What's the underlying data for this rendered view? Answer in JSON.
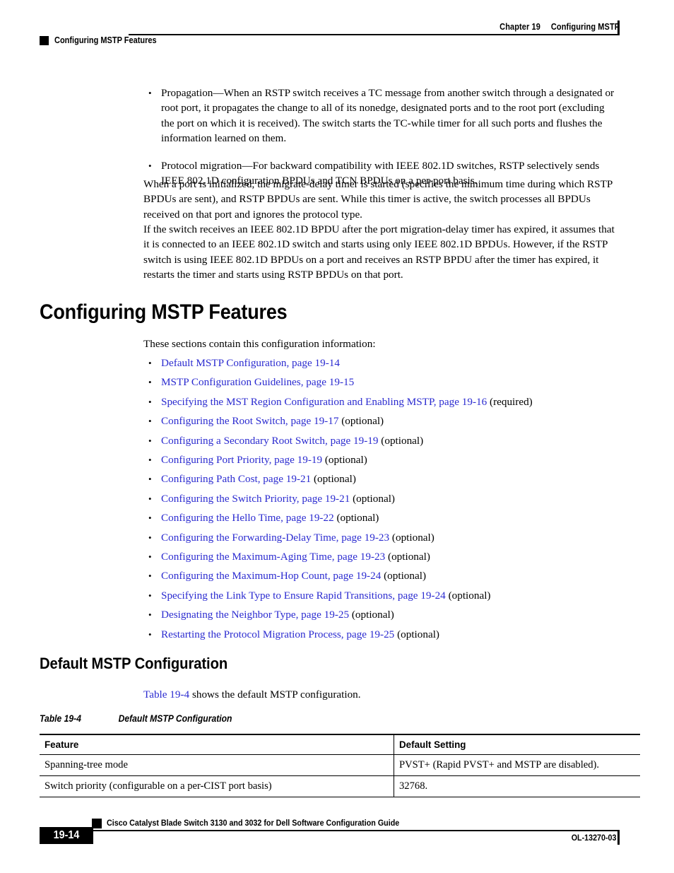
{
  "header": {
    "chapter_label": "Chapter 19",
    "chapter_title": "Configuring MSTP",
    "running_title": "Configuring MSTP Features"
  },
  "intro_bullets": [
    "Propagation—When an RSTP switch receives a TC message from another switch through a designated or root port, it propagates the change to all of its nonedge, designated ports and to the root port (excluding the port on which it is received). The switch starts the TC-while timer for all such ports and flushes the information learned on them.",
    "Protocol migration—For backward compatibility with IEEE 802.1D switches, RSTP selectively sends IEEE 802.1D configuration BPDUs and TCN BPDUs on a per-port basis."
  ],
  "paragraphs": [
    "When a port is initialized, the migrate-delay timer is started (specifies the minimum time during which RSTP BPDUs are sent), and RSTP BPDUs are sent. While this timer is active, the switch processes all BPDUs received on that port and ignores the protocol type.",
    "If the switch receives an IEEE 802.1D BPDU after the port migration-delay timer has expired, it assumes that it is connected to an IEEE 802.1D switch and starts using only IEEE 802.1D BPDUs. However, if the RSTP switch is using IEEE 802.1D BPDUs on a port and receives an RSTP BPDU after the timer has expired, it restarts the timer and starts using RSTP BPDUs on that port."
  ],
  "section": {
    "heading": "Configuring MSTP Features",
    "lead_in": "These sections contain this configuration information:",
    "links": [
      {
        "text": "Default MSTP Configuration, page 19-14",
        "suffix": ""
      },
      {
        "text": "MSTP Configuration Guidelines, page 19-15",
        "suffix": ""
      },
      {
        "text": "Specifying the MST Region Configuration and Enabling MSTP, page 19-16",
        "suffix": " (required)"
      },
      {
        "text": "Configuring the Root Switch, page 19-17",
        "suffix": " (optional)"
      },
      {
        "text": "Configuring a Secondary Root Switch, page 19-19",
        "suffix": " (optional)"
      },
      {
        "text": "Configuring Port Priority, page 19-19",
        "suffix": " (optional)"
      },
      {
        "text": "Configuring Path Cost, page 19-21",
        "suffix": " (optional)"
      },
      {
        "text": "Configuring the Switch Priority, page 19-21",
        "suffix": " (optional)"
      },
      {
        "text": "Configuring the Hello Time, page 19-22",
        "suffix": " (optional)"
      },
      {
        "text": "Configuring the Forwarding-Delay Time, page 19-23",
        "suffix": " (optional)"
      },
      {
        "text": "Configuring the Maximum-Aging Time, page 19-23",
        "suffix": " (optional)"
      },
      {
        "text": "Configuring the Maximum-Hop Count, page 19-24",
        "suffix": " (optional)"
      },
      {
        "text": "Specifying the Link Type to Ensure Rapid Transitions, page 19-24",
        "suffix": " (optional)"
      },
      {
        "text": "Designating the Neighbor Type, page 19-25",
        "suffix": " (optional)"
      },
      {
        "text": "Restarting the Protocol Migration Process, page 19-25",
        "suffix": " (optional)"
      }
    ]
  },
  "subsection": {
    "heading": "Default MSTP Configuration",
    "intro_link": "Table 19-4",
    "intro_rest": " shows the default MSTP configuration."
  },
  "table": {
    "caption_label": "Table 19-4",
    "caption_title": "Default MSTP Configuration",
    "columns": [
      "Feature",
      "Default Setting"
    ],
    "rows": [
      [
        "Spanning-tree mode",
        "PVST+ (Rapid PVST+ and MSTP are disabled)."
      ],
      [
        "Switch priority (configurable on a per-CIST port basis)",
        "32768."
      ]
    ]
  },
  "footer": {
    "guide_title": "Cisco Catalyst Blade Switch 3130 and 3032 for Dell Software Configuration Guide",
    "page_number": "19-14",
    "doc_id": "OL-13270-03"
  },
  "colors": {
    "link": "#2b2bd0",
    "text": "#000000",
    "background": "#ffffff"
  }
}
